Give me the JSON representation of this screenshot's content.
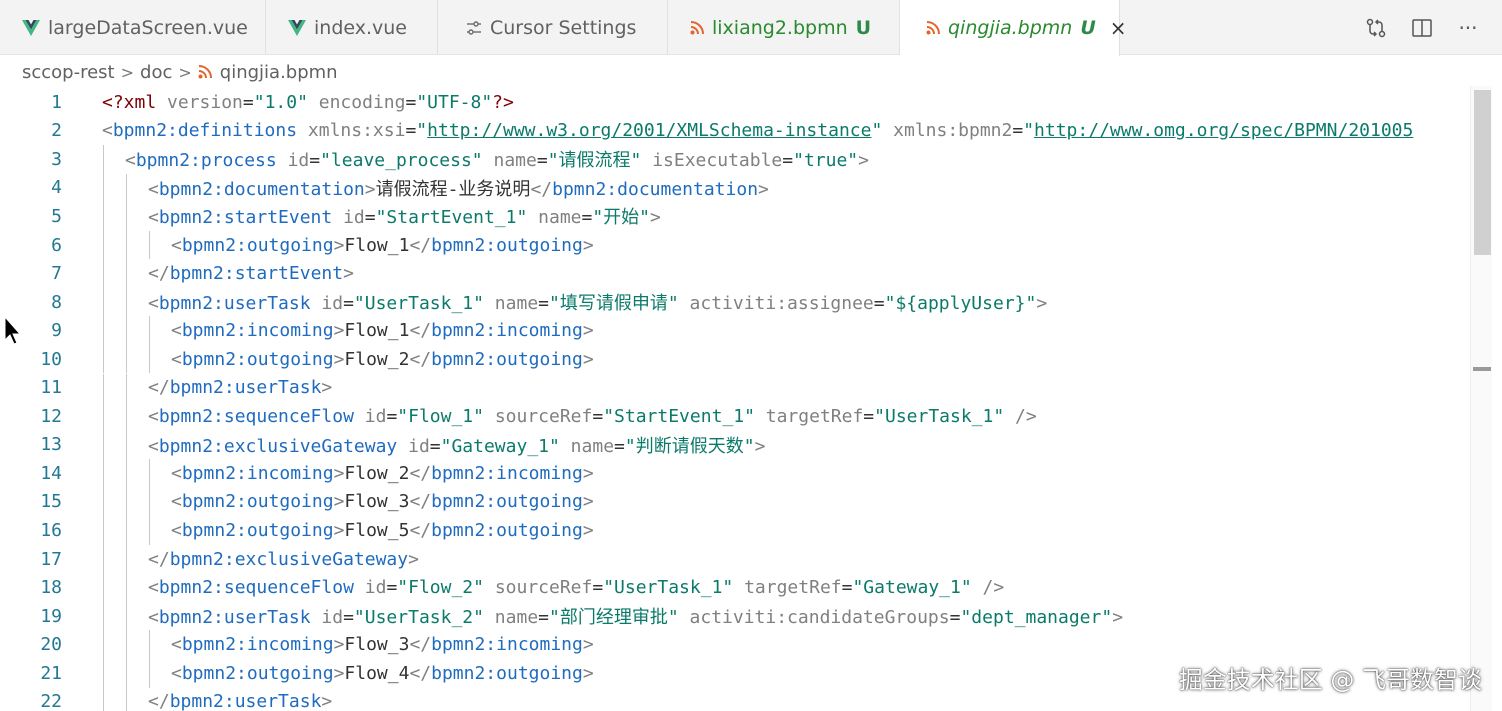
{
  "tabs": [
    {
      "label": "largeDataScreen.vue",
      "icon": "vue-icon",
      "active": false
    },
    {
      "label": "index.vue",
      "icon": "vue-icon",
      "active": false
    },
    {
      "label": "Cursor Settings",
      "icon": "settings-sliders-icon",
      "active": false
    },
    {
      "label": "lixiang2.bpmn",
      "icon": "rss-icon",
      "badge": "U",
      "active": false
    },
    {
      "label": "qingjia.bpmn",
      "icon": "rss-icon",
      "badge": "U",
      "active": true,
      "close": "×"
    }
  ],
  "toolbar_actions": [
    "source-control-compare-icon",
    "split-editor-icon",
    "more-actions-icon"
  ],
  "toolbar_more": "···",
  "breadcrumb": {
    "root": "sccop-rest",
    "folder": "doc",
    "file": "qingjia.bpmn",
    "separator": ">"
  },
  "editor": {
    "lines": [
      {
        "n": "1",
        "indent": 0,
        "tokens": [
          [
            "pi",
            "<?xml "
          ],
          [
            "attr",
            "version"
          ],
          [
            "eq",
            "="
          ],
          [
            "str",
            "\"1.0\""
          ],
          [
            "attr",
            " encoding"
          ],
          [
            "eq",
            "="
          ],
          [
            "str",
            "\"UTF-8\""
          ],
          [
            "pi",
            "?>"
          ]
        ]
      },
      {
        "n": "2",
        "indent": 0,
        "tokens": [
          [
            "br",
            "<"
          ],
          [
            "tag",
            "bpmn2:definitions"
          ],
          [
            "attr",
            " xmlns:xsi"
          ],
          [
            "eq",
            "="
          ],
          [
            "str",
            "\""
          ],
          [
            "url",
            "http://www.w3.org/2001/XMLSchema-instance"
          ],
          [
            "str",
            "\""
          ],
          [
            "attr",
            " xmlns:bpmn2"
          ],
          [
            "eq",
            "="
          ],
          [
            "str",
            "\""
          ],
          [
            "url",
            "http://www.omg.org/spec/BPMN/201005"
          ]
        ]
      },
      {
        "n": "3",
        "indent": 1,
        "tokens": [
          [
            "br",
            "<"
          ],
          [
            "tag",
            "bpmn2:process"
          ],
          [
            "attr",
            " id"
          ],
          [
            "eq",
            "="
          ],
          [
            "str",
            "\"leave_process\""
          ],
          [
            "attr",
            " name"
          ],
          [
            "eq",
            "="
          ],
          [
            "str",
            "\"请假流程\""
          ],
          [
            "attr",
            " isExecutable"
          ],
          [
            "eq",
            "="
          ],
          [
            "str",
            "\"true\""
          ],
          [
            "br",
            ">"
          ]
        ]
      },
      {
        "n": "4",
        "indent": 2,
        "tokens": [
          [
            "br",
            "<"
          ],
          [
            "tag",
            "bpmn2:documentation"
          ],
          [
            "br",
            ">"
          ],
          [
            "txt",
            "请假流程-业务说明"
          ],
          [
            "br",
            "</"
          ],
          [
            "tag",
            "bpmn2:documentation"
          ],
          [
            "br",
            ">"
          ]
        ]
      },
      {
        "n": "5",
        "indent": 2,
        "tokens": [
          [
            "br",
            "<"
          ],
          [
            "tag",
            "bpmn2:startEvent"
          ],
          [
            "attr",
            " id"
          ],
          [
            "eq",
            "="
          ],
          [
            "str",
            "\"StartEvent_1\""
          ],
          [
            "attr",
            " name"
          ],
          [
            "eq",
            "="
          ],
          [
            "str",
            "\"开始\""
          ],
          [
            "br",
            ">"
          ]
        ]
      },
      {
        "n": "6",
        "indent": 3,
        "tokens": [
          [
            "br",
            "<"
          ],
          [
            "tag",
            "bpmn2:outgoing"
          ],
          [
            "br",
            ">"
          ],
          [
            "txt",
            "Flow_1"
          ],
          [
            "br",
            "</"
          ],
          [
            "tag",
            "bpmn2:outgoing"
          ],
          [
            "br",
            ">"
          ]
        ]
      },
      {
        "n": "7",
        "indent": 2,
        "tokens": [
          [
            "br",
            "</"
          ],
          [
            "tag",
            "bpmn2:startEvent"
          ],
          [
            "br",
            ">"
          ]
        ]
      },
      {
        "n": "8",
        "indent": 2,
        "tokens": [
          [
            "br",
            "<"
          ],
          [
            "tag",
            "bpmn2:userTask"
          ],
          [
            "attr",
            " id"
          ],
          [
            "eq",
            "="
          ],
          [
            "str",
            "\"UserTask_1\""
          ],
          [
            "attr",
            " name"
          ],
          [
            "eq",
            "="
          ],
          [
            "str",
            "\"填写请假申请\""
          ],
          [
            "attr",
            " activiti:assignee"
          ],
          [
            "eq",
            "="
          ],
          [
            "str",
            "\"${applyUser}\""
          ],
          [
            "br",
            ">"
          ]
        ]
      },
      {
        "n": "9",
        "indent": 3,
        "tokens": [
          [
            "br",
            "<"
          ],
          [
            "tag",
            "bpmn2:incoming"
          ],
          [
            "br",
            ">"
          ],
          [
            "txt",
            "Flow_1"
          ],
          [
            "br",
            "</"
          ],
          [
            "tag",
            "bpmn2:incoming"
          ],
          [
            "br",
            ">"
          ]
        ]
      },
      {
        "n": "10",
        "indent": 3,
        "tokens": [
          [
            "br",
            "<"
          ],
          [
            "tag",
            "bpmn2:outgoing"
          ],
          [
            "br",
            ">"
          ],
          [
            "txt",
            "Flow_2"
          ],
          [
            "br",
            "</"
          ],
          [
            "tag",
            "bpmn2:outgoing"
          ],
          [
            "br",
            ">"
          ]
        ]
      },
      {
        "n": "11",
        "indent": 2,
        "tokens": [
          [
            "br",
            "</"
          ],
          [
            "tag",
            "bpmn2:userTask"
          ],
          [
            "br",
            ">"
          ]
        ]
      },
      {
        "n": "12",
        "indent": 2,
        "tokens": [
          [
            "br",
            "<"
          ],
          [
            "tag",
            "bpmn2:sequenceFlow"
          ],
          [
            "attr",
            " id"
          ],
          [
            "eq",
            "="
          ],
          [
            "str",
            "\"Flow_1\""
          ],
          [
            "attr",
            " sourceRef"
          ],
          [
            "eq",
            "="
          ],
          [
            "str",
            "\"StartEvent_1\""
          ],
          [
            "attr",
            " targetRef"
          ],
          [
            "eq",
            "="
          ],
          [
            "str",
            "\"UserTask_1\""
          ],
          [
            "br",
            " />"
          ]
        ]
      },
      {
        "n": "13",
        "indent": 2,
        "tokens": [
          [
            "br",
            "<"
          ],
          [
            "tag",
            "bpmn2:exclusiveGateway"
          ],
          [
            "attr",
            " id"
          ],
          [
            "eq",
            "="
          ],
          [
            "str",
            "\"Gateway_1\""
          ],
          [
            "attr",
            " name"
          ],
          [
            "eq",
            "="
          ],
          [
            "str",
            "\"判断请假天数\""
          ],
          [
            "br",
            ">"
          ]
        ]
      },
      {
        "n": "14",
        "indent": 3,
        "tokens": [
          [
            "br",
            "<"
          ],
          [
            "tag",
            "bpmn2:incoming"
          ],
          [
            "br",
            ">"
          ],
          [
            "txt",
            "Flow_2"
          ],
          [
            "br",
            "</"
          ],
          [
            "tag",
            "bpmn2:incoming"
          ],
          [
            "br",
            ">"
          ]
        ]
      },
      {
        "n": "15",
        "indent": 3,
        "tokens": [
          [
            "br",
            "<"
          ],
          [
            "tag",
            "bpmn2:outgoing"
          ],
          [
            "br",
            ">"
          ],
          [
            "txt",
            "Flow_3"
          ],
          [
            "br",
            "</"
          ],
          [
            "tag",
            "bpmn2:outgoing"
          ],
          [
            "br",
            ">"
          ]
        ]
      },
      {
        "n": "16",
        "indent": 3,
        "tokens": [
          [
            "br",
            "<"
          ],
          [
            "tag",
            "bpmn2:outgoing"
          ],
          [
            "br",
            ">"
          ],
          [
            "txt",
            "Flow_5"
          ],
          [
            "br",
            "</"
          ],
          [
            "tag",
            "bpmn2:outgoing"
          ],
          [
            "br",
            ">"
          ]
        ]
      },
      {
        "n": "17",
        "indent": 2,
        "tokens": [
          [
            "br",
            "</"
          ],
          [
            "tag",
            "bpmn2:exclusiveGateway"
          ],
          [
            "br",
            ">"
          ]
        ]
      },
      {
        "n": "18",
        "indent": 2,
        "tokens": [
          [
            "br",
            "<"
          ],
          [
            "tag",
            "bpmn2:sequenceFlow"
          ],
          [
            "attr",
            " id"
          ],
          [
            "eq",
            "="
          ],
          [
            "str",
            "\"Flow_2\""
          ],
          [
            "attr",
            " sourceRef"
          ],
          [
            "eq",
            "="
          ],
          [
            "str",
            "\"UserTask_1\""
          ],
          [
            "attr",
            " targetRef"
          ],
          [
            "eq",
            "="
          ],
          [
            "str",
            "\"Gateway_1\""
          ],
          [
            "br",
            " />"
          ]
        ]
      },
      {
        "n": "19",
        "indent": 2,
        "tokens": [
          [
            "br",
            "<"
          ],
          [
            "tag",
            "bpmn2:userTask"
          ],
          [
            "attr",
            " id"
          ],
          [
            "eq",
            "="
          ],
          [
            "str",
            "\"UserTask_2\""
          ],
          [
            "attr",
            " name"
          ],
          [
            "eq",
            "="
          ],
          [
            "str",
            "\"部门经理审批\""
          ],
          [
            "attr",
            " activiti:candidateGroups"
          ],
          [
            "eq",
            "="
          ],
          [
            "str",
            "\"dept_manager\""
          ],
          [
            "br",
            ">"
          ]
        ]
      },
      {
        "n": "20",
        "indent": 3,
        "tokens": [
          [
            "br",
            "<"
          ],
          [
            "tag",
            "bpmn2:incoming"
          ],
          [
            "br",
            ">"
          ],
          [
            "txt",
            "Flow_3"
          ],
          [
            "br",
            "</"
          ],
          [
            "tag",
            "bpmn2:incoming"
          ],
          [
            "br",
            ">"
          ]
        ]
      },
      {
        "n": "21",
        "indent": 3,
        "tokens": [
          [
            "br",
            "<"
          ],
          [
            "tag",
            "bpmn2:outgoing"
          ],
          [
            "br",
            ">"
          ],
          [
            "txt",
            "Flow_4"
          ],
          [
            "br",
            "</"
          ],
          [
            "tag",
            "bpmn2:outgoing"
          ],
          [
            "br",
            ">"
          ]
        ]
      },
      {
        "n": "22",
        "indent": 2,
        "tokens": [
          [
            "br",
            "</"
          ],
          [
            "tag",
            "bpmn2:userTask"
          ],
          [
            "br",
            ">"
          ]
        ]
      }
    ]
  },
  "watermark": "掘金技术社区 @ 飞哥数智谈",
  "colors": {
    "tag": "#1f6bbf",
    "string": "#0b7a6a",
    "attribute": "#808080",
    "line_number": "#237893",
    "untracked_badge": "#2e8a48",
    "vue": "#41b883",
    "rss": "#e2662c"
  }
}
